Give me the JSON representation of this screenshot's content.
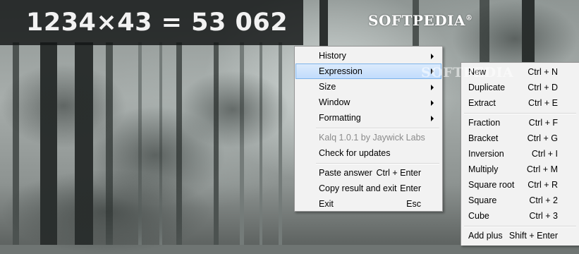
{
  "result_display": "1234×43 = 53 062",
  "brand_logo": "SOFTPEDIA",
  "brand_mark": "®",
  "main_menu": {
    "items": [
      {
        "label": "History",
        "shortcut": "",
        "submenu": true
      },
      {
        "label": "Expression",
        "shortcut": "",
        "submenu": true,
        "highlighted": true
      },
      {
        "label": "Size",
        "shortcut": "",
        "submenu": true
      },
      {
        "label": "Window",
        "shortcut": "",
        "submenu": true
      },
      {
        "label": "Formatting",
        "shortcut": "",
        "submenu": true
      },
      {
        "label": "Kalq 1.0.1 by Jaywick Labs",
        "shortcut": "",
        "disabled": true
      },
      {
        "label": "Check for updates",
        "shortcut": ""
      },
      {
        "label": "Paste answer",
        "shortcut": "Ctrl + Enter"
      },
      {
        "label": "Copy result and exit",
        "shortcut": "Enter"
      },
      {
        "label": "Exit",
        "shortcut": "Esc"
      }
    ]
  },
  "expression_menu": {
    "items": [
      {
        "label": "New",
        "shortcut": "Ctrl + N"
      },
      {
        "label": "Duplicate",
        "shortcut": "Ctrl + D"
      },
      {
        "label": "Extract",
        "shortcut": "Ctrl + E"
      },
      {
        "label": "Fraction",
        "shortcut": "Ctrl + F"
      },
      {
        "label": "Bracket",
        "shortcut": "Ctrl + G"
      },
      {
        "label": "Inversion",
        "shortcut": "Ctrl + I"
      },
      {
        "label": "Multiply",
        "shortcut": "Ctrl + M"
      },
      {
        "label": "Square root",
        "shortcut": "Ctrl + R"
      },
      {
        "label": "Square",
        "shortcut": "Ctrl + 2"
      },
      {
        "label": "Cube",
        "shortcut": "Ctrl + 3"
      },
      {
        "label": "Add plus",
        "shortcut": "Shift + Enter"
      }
    ]
  },
  "colors": {
    "highlight": "#c1dcfc",
    "highlight_border": "#7eb4ea",
    "menu_bg": "#f2f2f2",
    "disabled_text": "#8a8a8a"
  }
}
